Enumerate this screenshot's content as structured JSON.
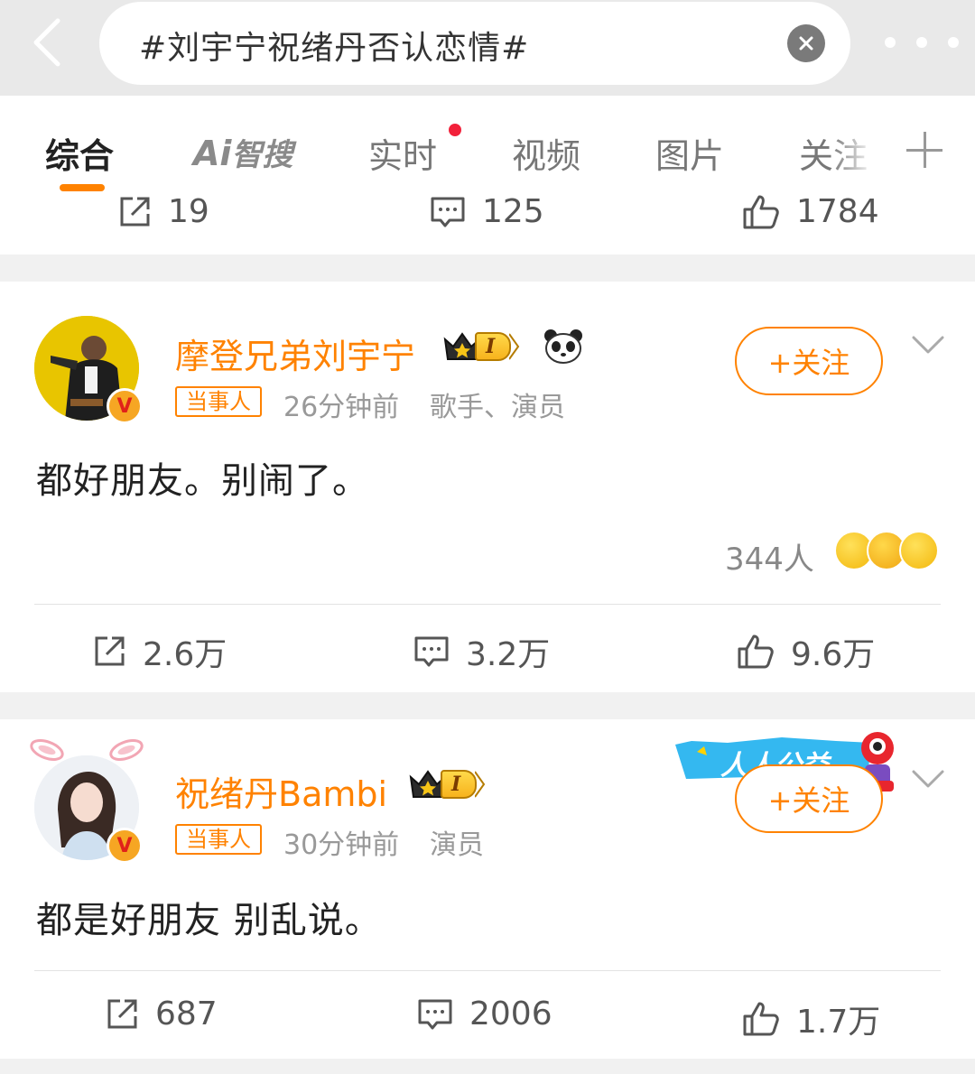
{
  "search": {
    "query": "#刘宇宁祝绪丹否认恋情#"
  },
  "tabs": [
    {
      "label": "综合"
    },
    {
      "label": "Ai"
    },
    {
      "label": "智搜"
    },
    {
      "label": "实时"
    },
    {
      "label": "视频"
    },
    {
      "label": "图片"
    },
    {
      "label": "关注"
    }
  ],
  "prev_post": {
    "reposts": "19",
    "comments": "125",
    "likes": "1784"
  },
  "posts": [
    {
      "username": "摩登兄弟刘宇宁",
      "level": "I",
      "role_tag": "当事人",
      "time": "26分钟前",
      "description": "歌手、演员",
      "follow_label": "+关注",
      "content": "都好朋友。别闹了。",
      "reaction_count": "344人",
      "reposts": "2.6万",
      "comments": "3.2万",
      "likes": "9.6万"
    },
    {
      "username": "祝绪丹Bambi",
      "level": "I",
      "role_tag": "当事人",
      "time": "30分钟前",
      "description": "演员",
      "follow_label": "+关注",
      "campaign_badge": "人人公益",
      "content": "都是好朋友 别乱说。",
      "reposts": "687",
      "comments": "2006",
      "likes": "1.7万"
    }
  ],
  "colors": {
    "accent": "#ff8200",
    "unread_dot": "#f2213a"
  }
}
